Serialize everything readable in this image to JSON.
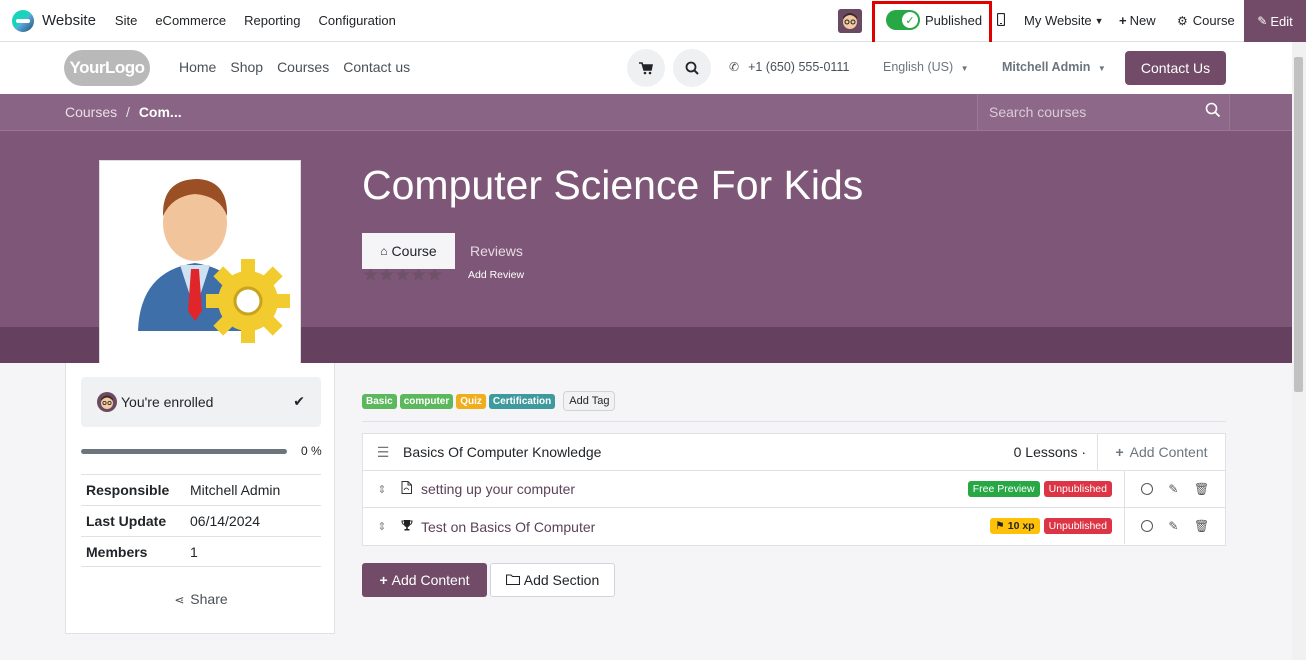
{
  "topbar": {
    "app_name": "Website",
    "menu": [
      "Site",
      "eCommerce",
      "Reporting",
      "Configuration"
    ],
    "published_label": "Published",
    "my_website_label": "My Website",
    "new_label": "New",
    "course_label": "Course",
    "edit_label": "Edit"
  },
  "header": {
    "logo_text": "YourLogo",
    "nav": [
      "Home",
      "Shop",
      "Courses",
      "Contact us"
    ],
    "phone": "+1 (650) 555-0111",
    "language": "English (US)",
    "user": "Mitchell Admin",
    "contact_button": "Contact Us"
  },
  "hero": {
    "breadcrumb_root": "Courses",
    "breadcrumb_sep": "/",
    "breadcrumb_current": "Com...",
    "search_placeholder": "Search courses",
    "course_title": "Computer Science For Kids",
    "stars": "★★★★★",
    "add_review": "Add Review",
    "tabs": [
      "Course",
      "Reviews"
    ]
  },
  "sidebar": {
    "enrolled_text": "You're enrolled",
    "progress_percent": 0,
    "progress_label": "0 %",
    "info": [
      {
        "key": "Responsible",
        "value": "Mitchell Admin"
      },
      {
        "key": "Last Update",
        "value": "06/14/2024"
      },
      {
        "key": "Members",
        "value": "1"
      }
    ],
    "share_label": "Share"
  },
  "main": {
    "tags": [
      {
        "label": "Basic",
        "color": "#5cb85c"
      },
      {
        "label": "computer",
        "color": "#5cb85c"
      },
      {
        "label": "Quiz",
        "color": "#f0ad1e"
      },
      {
        "label": "Certification",
        "color": "#3e9a9c"
      }
    ],
    "add_tag": "Add Tag",
    "section": {
      "title": "Basics Of Computer Knowledge",
      "lessons_count": "0 Lessons ·",
      "add_content": "Add Content"
    },
    "lessons": [
      {
        "title": "setting up your computer",
        "icon": "pdf-icon",
        "badges": [
          {
            "label": "Free Preview",
            "color": "#28a745"
          },
          {
            "label": "Unpublished",
            "color": "#dc3545"
          }
        ]
      },
      {
        "title": "Test on Basics Of Computer",
        "icon": "trophy-icon",
        "badges": [
          {
            "label": "10 xp",
            "color": "#ffc107"
          },
          {
            "label": "Unpublished",
            "color": "#dc3545"
          }
        ]
      }
    ],
    "add_content_button": "Add Content",
    "add_section_button": "Add Section"
  },
  "colors": {
    "brand": "#714b67",
    "hero": "#7e5677",
    "published": "#28a745",
    "highlight_box": "#e00000"
  }
}
